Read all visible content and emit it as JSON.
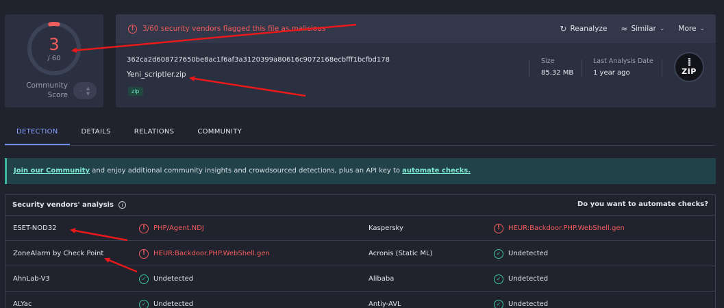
{
  "score": {
    "detected": "3",
    "total": "/ 60",
    "community_label": "Community Score",
    "vote_value": "-",
    "detected_fraction": 0.05
  },
  "alert": {
    "text": "3/60 security vendors flagged this file as malicious"
  },
  "actions": {
    "reanalyze": "Reanalyze",
    "similar": "Similar",
    "more": "More"
  },
  "file": {
    "hash": "362ca2d608727650be8ac1f6af3a3120399a80616c9072168ecbfff1bcfbd178",
    "name": "Yeni_scriptler.zip",
    "tag": "zip"
  },
  "meta": {
    "size_label": "Size",
    "size_value": "85.32 MB",
    "last_label": "Last Analysis Date",
    "last_value": "1 year ago",
    "type_badge": "ZIP"
  },
  "tabs": [
    "DETECTION",
    "DETAILS",
    "RELATIONS",
    "COMMUNITY"
  ],
  "banner": {
    "link1": "Join our Community",
    "middle": " and enjoy additional community insights and crowdsourced detections, plus an API key to ",
    "link2": "automate checks."
  },
  "analysis": {
    "title": "Security vendors' analysis",
    "automate": "Do you want to automate checks?",
    "rows": [
      {
        "v1": "ESET-NOD32",
        "r1": "PHP/Agent.NDJ",
        "s1": "malicious",
        "v2": "Kaspersky",
        "r2": "HEUR:Backdoor.PHP.WebShell.gen",
        "s2": "malicious"
      },
      {
        "v1": "ZoneAlarm by Check Point",
        "r1": "HEUR:Backdoor.PHP.WebShell.gen",
        "s1": "malicious",
        "v2": "Acronis (Static ML)",
        "r2": "Undetected",
        "s2": "undetected"
      },
      {
        "v1": "AhnLab-V3",
        "r1": "Undetected",
        "s1": "undetected",
        "v2": "Alibaba",
        "r2": "Undetected",
        "s2": "undetected"
      },
      {
        "v1": "ALYac",
        "r1": "Undetected",
        "s1": "undetected",
        "v2": "Antiy-AVL",
        "r2": "Undetected",
        "s2": "undetected"
      }
    ]
  },
  "colors": {
    "malicious": "#f25c5c",
    "clean": "#3bc59e",
    "accent": "#6f8cff",
    "annotation": "#e8191a"
  }
}
